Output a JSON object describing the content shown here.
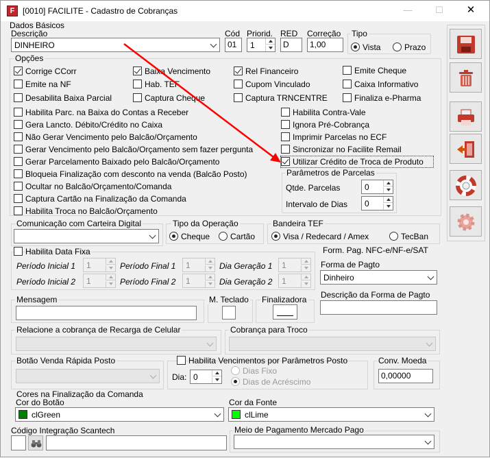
{
  "window": {
    "title": "[0010] FACILITE - Cadastro de Cobranças",
    "icon_letter": "F"
  },
  "dados_basicos": {
    "group": "Dados Básicos",
    "descricao_label": "Descrição",
    "descricao_value": "DINHEIRO",
    "cod_label": "Cód",
    "cod_value": "01",
    "priorid_label": "Priorid.",
    "priorid_value": "1",
    "red_label": "RED",
    "red_value": "D",
    "correcao_label": "Correção",
    "correcao_value": "1,00",
    "tipo_label": "Tipo",
    "tipo_vista": "Vista",
    "tipo_prazo": "Prazo"
  },
  "opcoes": {
    "group": "Opções",
    "grid": [
      {
        "label": "Corrige CCorr",
        "checked": true
      },
      {
        "label": "Baixa Vencimento",
        "checked": true
      },
      {
        "label": "Rel Financeiro",
        "checked": true
      },
      {
        "label": "Emite Cheque",
        "checked": false
      },
      {
        "label": "Emite na NF",
        "checked": false
      },
      {
        "label": "Hab. TEF",
        "checked": false
      },
      {
        "label": "Cupom Vinculado",
        "checked": false
      },
      {
        "label": "Caixa Informativo",
        "checked": false
      },
      {
        "label": "Desabilita Baixa Parcial",
        "checked": false
      },
      {
        "label": "Captura Cheque",
        "checked": false
      },
      {
        "label": "Captura TRNCENTRE",
        "checked": false
      },
      {
        "label": "Finaliza e-Pharma",
        "checked": false
      }
    ],
    "left_list": [
      "Habilita Parc. na Baixa do Contas a Receber",
      "Gera Lancto. Débito/Crédito no Caixa",
      "Não Gerar Vencimento pelo Balcão/Orçamento",
      "Gerar Vencimento pelo Balcão/Orçamento sem fazer pergunta",
      "Gerar Parcelamento Baixado pelo Balcão/Orçamento",
      "Bloqueia Finalização com desconto na venda (Balcão Posto)",
      "Ocultar no Balcão/Orçamento/Comanda",
      "Captura Cartão na Finalização da Comanda",
      "Habilita Troca no Balcão/Orçamento"
    ],
    "right_list": [
      {
        "label": "Habilita Contra-Vale",
        "checked": false
      },
      {
        "label": "Ignora Pré-Cobrança",
        "checked": false
      },
      {
        "label": "Imprimir Parcelas no ECF",
        "checked": false
      },
      {
        "label": "Sincronizar no Facilite Remail",
        "checked": false
      },
      {
        "label": "Utilizar Crédito de Troca de Produto",
        "checked": true
      }
    ],
    "parcelas": {
      "group": "Parâmetros de Parcelas",
      "qtde_label": "Qtde. Parcelas",
      "qtde_value": "0",
      "intervalo_label": "Intervalo de Dias",
      "intervalo_value": "0"
    }
  },
  "comunicacao": {
    "group": "Comunicação com Carteira Digital",
    "value": ""
  },
  "tipo_operacao": {
    "group": "Tipo da Operação",
    "cheque": "Cheque",
    "cartao": "Cartão"
  },
  "bandeira_tef": {
    "group": "Bandeira TEF",
    "visa": "Visa / Redecard / Amex",
    "tecban": "TecBan"
  },
  "data_fixa": {
    "check_label": "Habilita Data Fixa",
    "pi1_label": "Período Inicial 1",
    "pi1_value": "1",
    "pf1_label": "Período Final 1",
    "pf1_value": "1",
    "dg1_label": "Dia Geração 1",
    "dg1_value": "1",
    "pi2_label": "Período Inicial 2",
    "pi2_value": "1",
    "pf2_label": "Período Final 2",
    "pf2_value": "1",
    "dg2_label": "Dia Geração 2",
    "dg2_value": "1"
  },
  "nfce": {
    "group": "Form. Pag. NFC-e/NF-e/SAT",
    "forma_label": "Forma de Pagto",
    "forma_value": "Dinheiro",
    "descricao_label": "Descrição da Forma de Pagto",
    "descricao_value": ""
  },
  "mensagem": {
    "group": "Mensagem",
    "value": ""
  },
  "m_teclado": {
    "group": "M. Teclado"
  },
  "finalizadora": {
    "group": "Finalizadora"
  },
  "recarga": {
    "group": "Relacione a cobrança de Recarga de Celular",
    "value": ""
  },
  "cobranca_troco": {
    "group": "Cobrança para Troco",
    "value": ""
  },
  "botao_venda": {
    "group": "Botão Venda Rápida Posto",
    "value": ""
  },
  "venc_param": {
    "check_label": "Habilita Vencimentos por Parâmetros Posto",
    "dia_label": "Dia:",
    "dia_value": "0",
    "dias_fixo": "Dias Fixo",
    "dias_acrescimo": "Dias de Acréscimo"
  },
  "conv_moeda": {
    "group": "Conv. Moeda",
    "value": "0,00000"
  },
  "cores": {
    "group": "Cores na Finalização da Comanda",
    "botao_label": "Cor do Botão",
    "botao_value": "clGreen",
    "botao_color": "#008000",
    "fonte_label": "Cor da Fonte",
    "fonte_value": "clLime",
    "fonte_color": "#00ff00"
  },
  "scantech": {
    "group": "Código Integração Scantech",
    "code": "",
    "value": ""
  },
  "mercado_pago": {
    "group": "Meio de Pagamento Mercado Pago",
    "value": ""
  },
  "colors": {
    "annotation_arrow": "#ff0000"
  },
  "side_buttons": [
    "save-icon",
    "trash-icon",
    "printer-icon",
    "exit-door-icon",
    "lifebuoy-icon",
    "gear-icon"
  ]
}
